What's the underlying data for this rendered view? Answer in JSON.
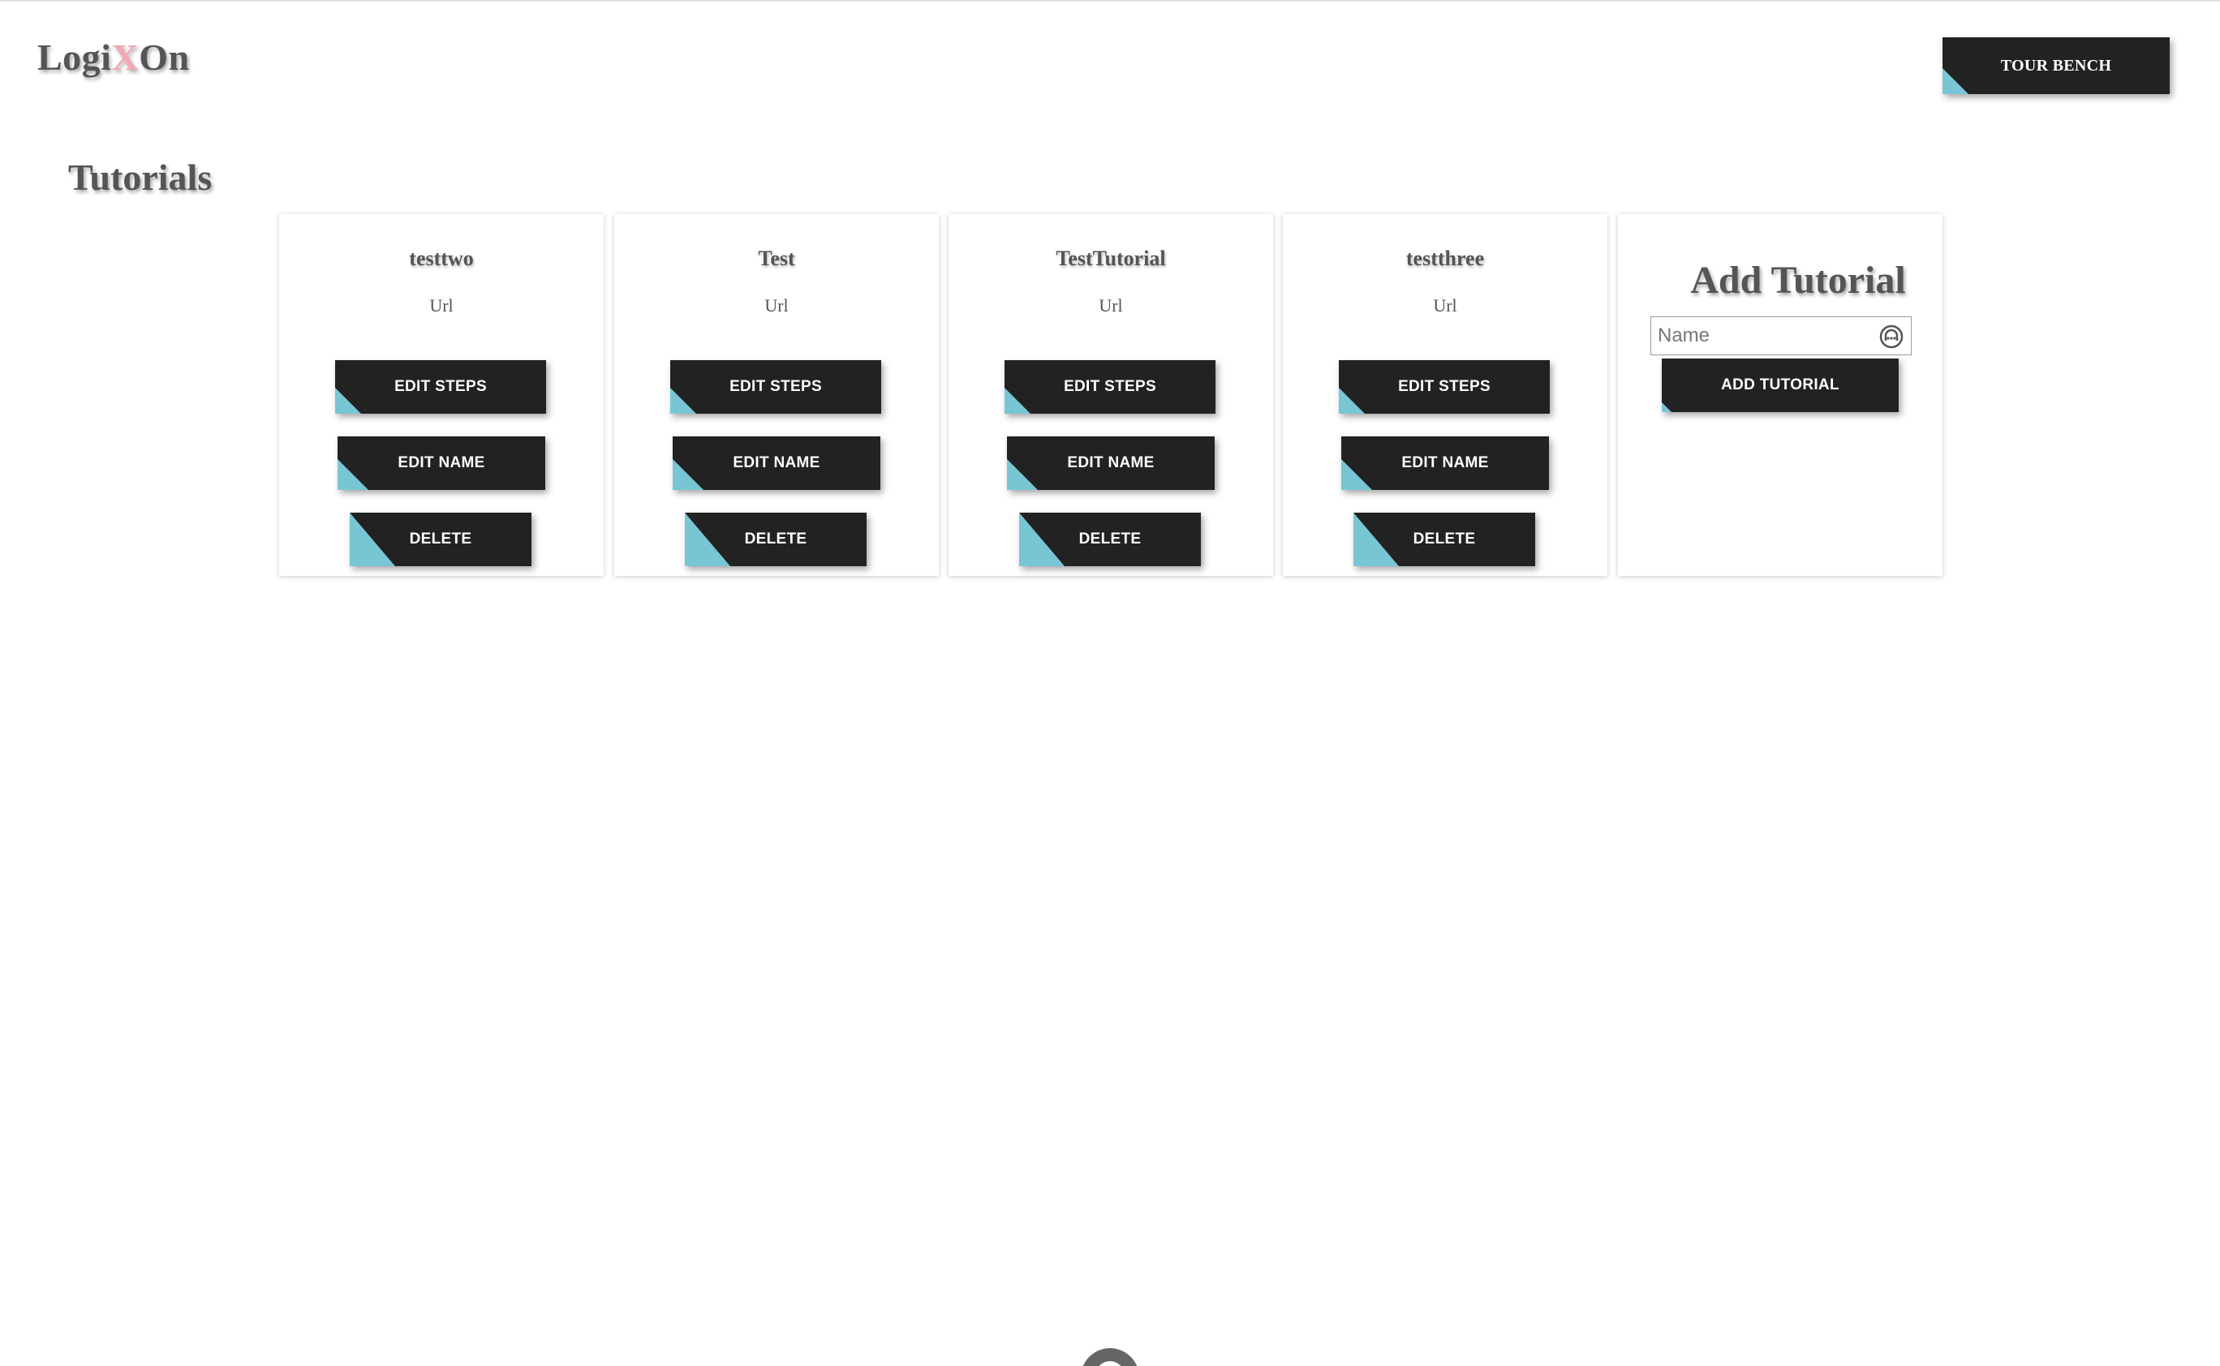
{
  "header": {
    "logo": {
      "pre": "Logi",
      "x": "X",
      "post": "On"
    },
    "tour_button": "TOUR BENCH"
  },
  "page_title": "Tutorials",
  "tutorials": [
    {
      "name": "testtwo",
      "url": "Url",
      "edit_steps": "EDIT STEPS",
      "edit_name": "EDIT NAME",
      "delete": "DELETE"
    },
    {
      "name": "Test",
      "url": "Url",
      "edit_steps": "EDIT STEPS",
      "edit_name": "EDIT NAME",
      "delete": "DELETE"
    },
    {
      "name": "TestTutorial",
      "url": "Url",
      "edit_steps": "EDIT STEPS",
      "edit_name": "EDIT NAME",
      "delete": "DELETE"
    },
    {
      "name": "testthree",
      "url": "Url",
      "edit_steps": "EDIT STEPS",
      "edit_name": "EDIT NAME",
      "delete": "DELETE"
    }
  ],
  "add_tutorial": {
    "title": "Add Tutorial",
    "name_placeholder": "Name",
    "name_value": "",
    "button": "ADD TUTORIAL",
    "field_icon": "password-manager-icon"
  },
  "colors": {
    "button_bg": "#222222",
    "button_corner": "#78c6d4",
    "logo_x": "#f4a6b4",
    "heading": "#555555"
  }
}
